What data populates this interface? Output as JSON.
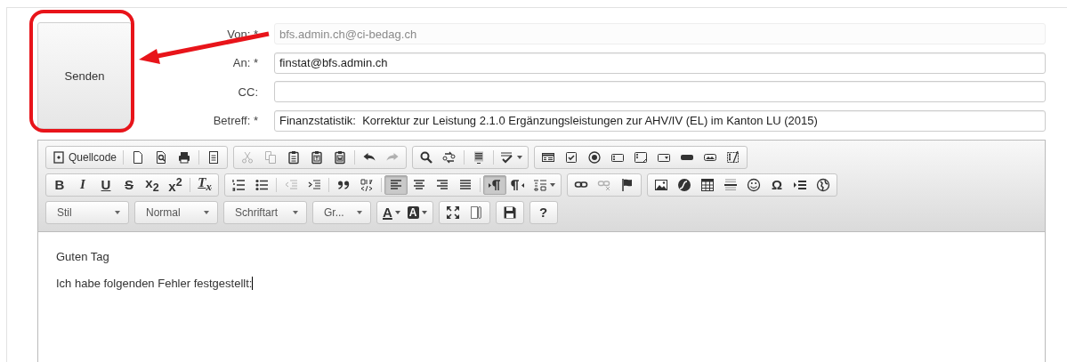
{
  "send_button": {
    "label": "Senden"
  },
  "fields": [
    {
      "label": "Von: *",
      "value": "bfs.admin.ch@ci-bedag.ch",
      "disabled": true
    },
    {
      "label": "An: *",
      "value": "finstat@bfs.admin.ch",
      "disabled": false
    },
    {
      "label": "CC:",
      "disabled": false
    },
    {
      "label": "Betreff: *",
      "value": "Finanzstatistik:  Korrektur zur Leistung 2.1.0 Ergänzungsleistungen zur AHV/IV (EL) im Kanton LU (2015)",
      "disabled": false
    }
  ],
  "toolbar": {
    "rows": [
      {
        "groups": [
          {
            "items": [
              {
                "kind": "icon",
                "label": "Quellcode"
              },
              {
                "kind": "separator"
              },
              {
                "kind": "icon"
              },
              {
                "kind": "icon"
              },
              {
                "kind": "icon"
              },
              {
                "kind": "separator"
              },
              {
                "kind": "icon"
              }
            ]
          },
          {
            "items": [
              {
                "kind": "icon",
                "disabled": true
              },
              {
                "kind": "icon",
                "disabled": true
              },
              {
                "kind": "icon"
              },
              {
                "kind": "icon"
              },
              {
                "kind": "icon"
              },
              {
                "kind": "separator"
              },
              {
                "kind": "icon"
              },
              {
                "kind": "icon",
                "disabled": true
              }
            ]
          },
          {
            "items": [
              {
                "kind": "icon"
              },
              {
                "kind": "icon"
              },
              {
                "kind": "separator"
              },
              {
                "kind": "icon"
              },
              {
                "kind": "separator"
              },
              {
                "kind": "icon",
                "menu": true
              }
            ]
          },
          {
            "items": [
              {
                "kind": "icon"
              },
              {
                "kind": "icon"
              },
              {
                "kind": "icon"
              },
              {
                "kind": "icon"
              },
              {
                "kind": "icon"
              },
              {
                "kind": "icon"
              },
              {
                "kind": "icon"
              },
              {
                "kind": "icon"
              },
              {
                "kind": "icon"
              }
            ]
          }
        ]
      },
      {
        "groups": [
          {
            "items": [
              {
                "kind": "glyph",
                "glyph": "B"
              },
              {
                "kind": "glyph",
                "glyph": "I"
              },
              {
                "kind": "glyph",
                "glyph": "U"
              },
              {
                "kind": "glyph",
                "glyph": "S"
              },
              {
                "kind": "glyph",
                "glyph": "x$_{2}$"
              },
              {
                "kind": "glyph",
                "glyph": "x$^{2}$"
              },
              {
                "kind": "separator"
              },
              {
                "kind": "glyph",
                "glyph": "T$_{x}$"
              }
            ]
          },
          {
            "items": [
              {
                "kind": "icon"
              },
              {
                "kind": "icon"
              },
              {
                "kind": "separator"
              },
              {
                "kind": "icon",
                "disabled": true
              },
              {
                "kind": "icon"
              },
              {
                "kind": "separator"
              },
              {
                "kind": "icon"
              },
              {
                "kind": "icon"
              },
              {
                "kind": "separator"
              },
              {
                "kind": "icon",
                "pressed": true
              },
              {
                "kind": "icon",
                "pressed": false
              },
              {
                "kind": "icon",
                "pressed": false
              },
              {
                "kind": "icon",
                "pressed": false
              },
              {
                "kind": "separator"
              },
              {
                "kind": "icon",
                "pressed": true
              },
              {
                "kind": "icon",
                "pressed": false
              },
              {
                "kind": "icon",
                "menu": true
              }
            ]
          },
          {
            "items": [
              {
                "kind": "icon"
              },
              {
                "kind": "icon",
                "disabled": true
              },
              {
                "kind": "icon"
              }
            ]
          },
          {
            "items": [
              {
                "kind": "icon"
              },
              {
                "kind": "icon"
              },
              {
                "kind": "icon"
              },
              {
                "kind": "icon"
              },
              {
                "kind": "icon"
              },
              {
                "kind": "glyph",
                "glyph": "Ω"
              },
              {
                "kind": "icon"
              },
              {
                "kind": "icon"
              }
            ]
          }
        ]
      },
      {
        "groups": [
          {
            "items": [
              {
                "kind": "combo",
                "label": "Stil"
              }
            ]
          },
          {
            "items": [
              {
                "kind": "combo",
                "label": "Normal"
              }
            ]
          },
          {
            "items": [
              {
                "kind": "combo",
                "label": "Schriftart"
              }
            ]
          },
          {
            "items": [
              {
                "kind": "combo",
                "label": "Gr..."
              }
            ]
          },
          {
            "items": [
              {
                "kind": "glyph",
                "glyph": "A",
                "menu": true
              },
              {
                "kind": "glyph",
                "glyph": "A",
                "menu": true
              }
            ]
          },
          {
            "items": [
              {
                "kind": "icon"
              },
              {
                "kind": "icon"
              }
            ]
          },
          {
            "items": [
              {
                "kind": "icon"
              }
            ]
          },
          {
            "items": [
              {
                "kind": "glyph",
                "glyph": "?"
              }
            ]
          }
        ]
      }
    ]
  },
  "body": {
    "paragraphs": [
      "Guten Tag",
      "Ich habe folgenden Fehler festgestellt:"
    ],
    "cursor": true
  }
}
